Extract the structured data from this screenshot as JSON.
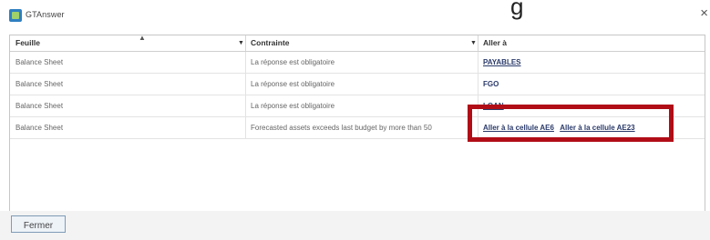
{
  "window": {
    "title": "GTAnswer",
    "close_glyph": "×",
    "headline": "g"
  },
  "table": {
    "columns": [
      "Feuille",
      "Contrainte",
      "Aller à"
    ],
    "rows": [
      {
        "feuille": "Balance Sheet",
        "contrainte": "La réponse est obligatoire",
        "links": [
          "PAYABLES"
        ]
      },
      {
        "feuille": "Balance Sheet",
        "contrainte": "La réponse est obligatoire",
        "links": [
          "FGO"
        ]
      },
      {
        "feuille": "Balance Sheet",
        "contrainte": "La réponse est obligatoire",
        "links": [
          "LOAN"
        ]
      },
      {
        "feuille": "Balance Sheet",
        "contrainte": "Forecasted assets exceeds last budget by more than 50",
        "links": [
          "Aller à la cellule AE6",
          "Aller à la cellule AE23"
        ]
      }
    ]
  },
  "footer": {
    "close_button_label": "Fermer"
  },
  "colors": {
    "highlight": "#b00d17",
    "link": "#2a3a6a"
  }
}
